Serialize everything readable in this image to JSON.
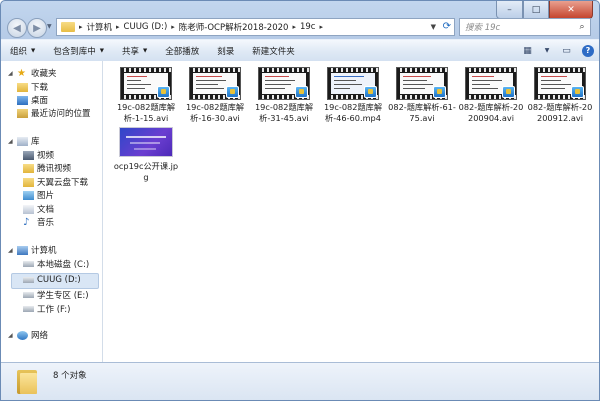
{
  "window": {
    "buttons": {
      "minimize": "–",
      "maximize": "□",
      "close": "✕"
    }
  },
  "nav_buttons": {
    "back": "◀",
    "forward": "▶"
  },
  "address": {
    "crumbs": [
      "计算机",
      "CUUG (D:)",
      "陈老师-OCP解析2018-2020",
      "19c"
    ]
  },
  "search": {
    "placeholder": "搜索 19c"
  },
  "toolbar": {
    "organize": "组织",
    "include_in_library": "包含到库中",
    "share": "共享",
    "play_all": "全部播放",
    "burn": "刻录",
    "new_folder": "新建文件夹"
  },
  "sidebar": {
    "favorites": "收藏夹",
    "downloads": "下载",
    "desktop": "桌面",
    "recent": "最近访问的位置",
    "libraries": "库",
    "videos": "视频",
    "tencent_video": "腾讯视频",
    "tianyi_download": "天翼云盘下载",
    "pictures": "图片",
    "documents": "文档",
    "music": "音乐",
    "computer": "计算机",
    "local_disk_c": "本地磁盘 (C:)",
    "cuug_d": "CUUG (D:)",
    "student_e": "学生专区 (E:)",
    "work_f": "工作 (F:)",
    "network": "网络"
  },
  "files": [
    {
      "name": "19c-082题库解析-1-15.avi",
      "kind": "video"
    },
    {
      "name": "19c-082题库解析-16-30.avi",
      "kind": "video"
    },
    {
      "name": "19c-082题库解析-31-45.avi",
      "kind": "video"
    },
    {
      "name": "19c-082题库解析-46-60.mp4",
      "kind": "video"
    },
    {
      "name": "082-题库解析-61-75.avi",
      "kind": "video"
    },
    {
      "name": "082-题库解析-20200904.avi",
      "kind": "video"
    },
    {
      "name": "082-题库解析-20200912.avi",
      "kind": "video"
    },
    {
      "name": "ocp19c公开课.jpg",
      "kind": "image"
    }
  ],
  "status": {
    "count_text": "8 个对象"
  },
  "colors": {
    "accent": "#2d6bc5",
    "window_frame": "#b5cae6",
    "selection": "#d9e6f5"
  }
}
